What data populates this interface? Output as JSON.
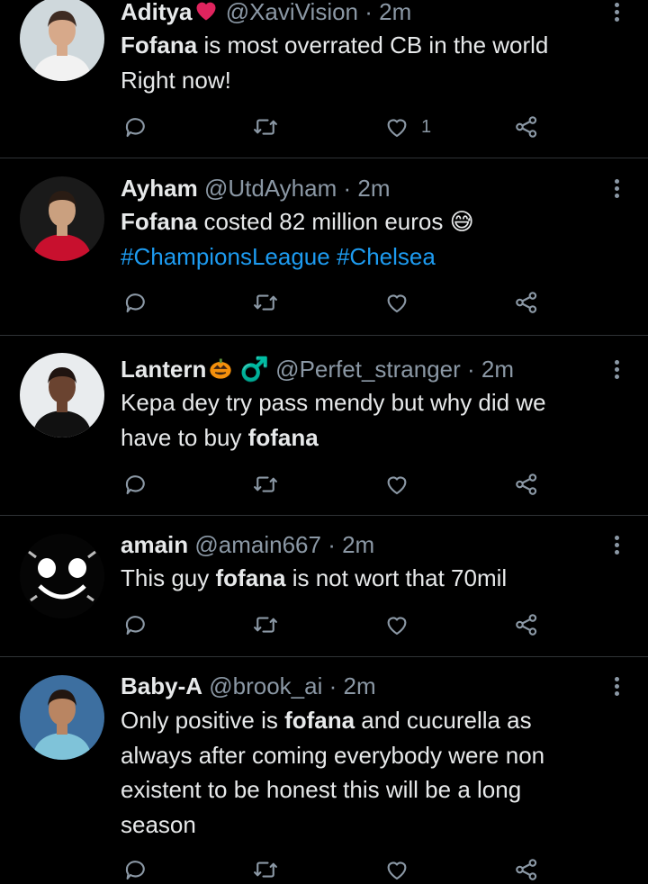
{
  "tweets": [
    {
      "name": "Aditya",
      "name_emoji": "red-heart",
      "handle": "@XaviVision",
      "time": "2m",
      "text_lines": [
        [
          {
            "t": "Fofana",
            "b": true
          },
          {
            "t": " is most overrated CB in the world"
          }
        ],
        [
          {
            "t": "Right now!"
          }
        ]
      ],
      "likes": "1",
      "avatar_colors": {
        "bg": "#cfd8dc",
        "skin": "#d7a98a",
        "hair": "#3e2b22",
        "shirt": "#f2f2f2"
      }
    },
    {
      "name": "Ayham",
      "name_emoji": "",
      "handle": "@UtdAyham",
      "time": "2m",
      "text_lines": [
        [
          {
            "t": "Fofana",
            "b": true
          },
          {
            "t": " costed 82 million euros "
          },
          {
            "t": "😅"
          }
        ],
        [
          {
            "t": "#ChampionsLeague",
            "tag": true
          },
          {
            "t": " "
          },
          {
            "t": "#Chelsea",
            "tag": true
          }
        ]
      ],
      "likes": "",
      "avatar_colors": {
        "bg": "#1a1a1a",
        "skin": "#caa07f",
        "hair": "#2a1c14",
        "shirt": "#c8102e"
      }
    },
    {
      "name": "Lantern",
      "name_emoji": "pumpkin",
      "name_suffix": "♂️",
      "handle": "@Perfet_stranger",
      "time": "2m",
      "text_lines": [
        [
          {
            "t": "Kepa dey try pass mendy but why did we"
          }
        ],
        [
          {
            "t": "have to buy "
          },
          {
            "t": "fofana",
            "b": true
          }
        ]
      ],
      "likes": "",
      "avatar_colors": {
        "bg": "#e9ecee",
        "skin": "#6a4330",
        "hair": "#1f1410",
        "shirt": "#111111"
      }
    },
    {
      "name": "amain",
      "name_emoji": "",
      "handle": "@amain667",
      "time": "2m",
      "text_lines": [
        [
          {
            "t": "This guy "
          },
          {
            "t": "fofana",
            "b": true
          },
          {
            "t": " is not wort that 70mil"
          }
        ]
      ],
      "likes": "",
      "avatar_colors": {
        "bg": "#050505",
        "skin": "#ffffff",
        "hair": "#ffffff",
        "shirt": "#ffffff"
      }
    },
    {
      "name": "Baby-A",
      "name_emoji": "",
      "handle": "@brook_ai",
      "time": "2m",
      "text_lines": [
        [
          {
            "t": "Only positive is "
          },
          {
            "t": "fofana",
            "b": true
          },
          {
            "t": " and cucurella as"
          }
        ],
        [
          {
            "t": "always after coming everybody were non"
          }
        ],
        [
          {
            "t": "existent to be honest this will be a long"
          }
        ],
        [
          {
            "t": "season"
          }
        ]
      ],
      "likes": "",
      "avatar_colors": {
        "bg": "#3d6fa0",
        "skin": "#b98562",
        "hair": "#221610",
        "shirt": "#7fc3d9"
      }
    }
  ],
  "icons": {
    "reply": "reply-icon",
    "retweet": "retweet-icon",
    "like": "heart-icon",
    "share": "share-icon",
    "more": "more-options-icon"
  },
  "colors": {
    "background": "#000000",
    "text": "#e7e9ea",
    "secondary": "#8b98a5",
    "link": "#1d9bf0",
    "divider": "#2f3336"
  }
}
